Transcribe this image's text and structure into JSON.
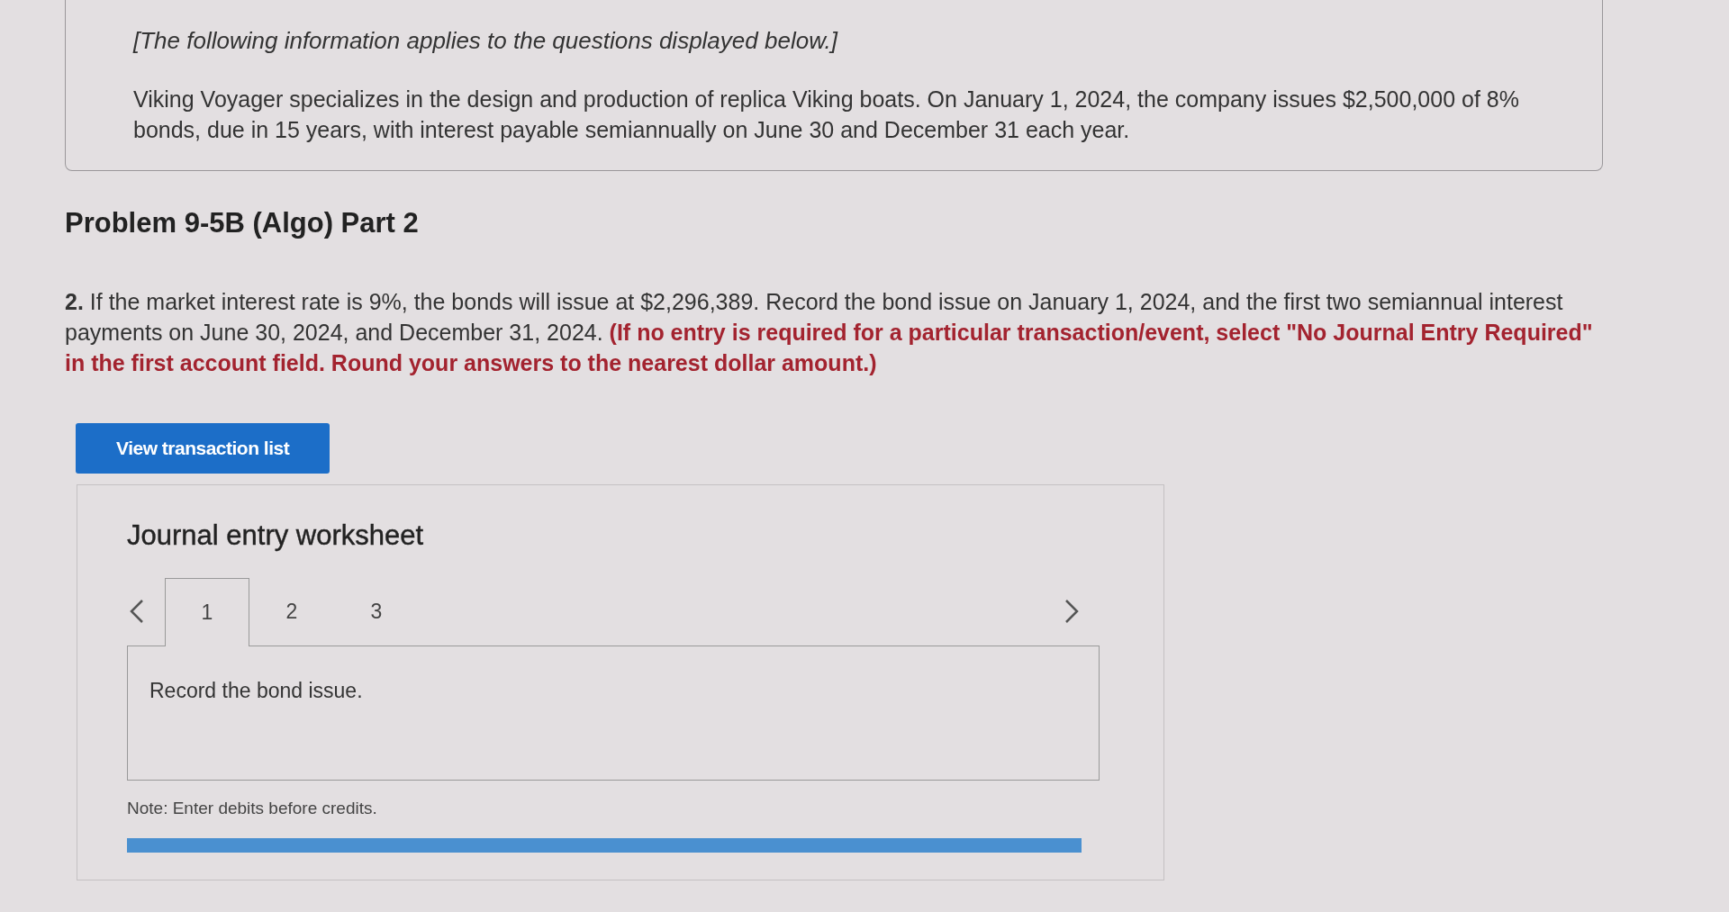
{
  "intro": {
    "note": "[The following information applies to the questions displayed below.]",
    "paragraph": "Viking Voyager specializes in the design and production of replica Viking boats. On January 1, 2024, the company issues $2,500,000 of 8% bonds, due in 15 years, with interest payable semiannually on June 30 and December 31 each year."
  },
  "heading": "Problem 9-5B (Algo) Part 2",
  "question": "**2.** If the market interest rate is 9%, the bonds will issue at $2,296,389. Record the bond issue on January 1, 2024, and the first two semiannual interest payments on June 30, 2024, and December 31, 2024.",
  "instruction": "(If no entry is required for a particular transaction/event, select \"No Journal Entry Required\" in the first account field. Round your answers to the nearest dollar amount.)",
  "button": "View transaction list",
  "worksheet": {
    "title": "Journal entry worksheet",
    "tabs": [
      {
        "label": "1",
        "selected": true
      },
      {
        "label": "2",
        "selected": false
      },
      {
        "label": "3",
        "selected": false
      }
    ],
    "prompt": "Record the bond issue.",
    "note": "Note: Enter debits before credits."
  }
}
